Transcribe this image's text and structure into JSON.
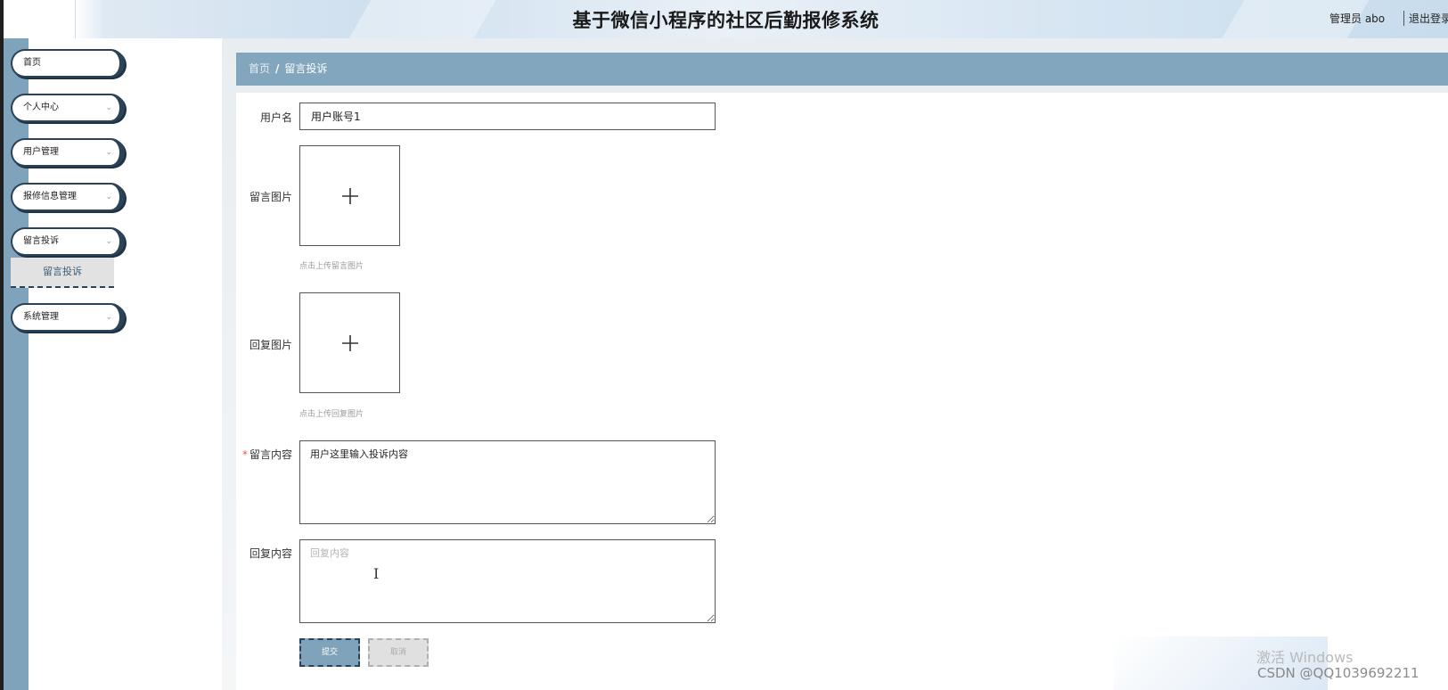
{
  "header": {
    "title": "基于微信小程序的社区后勤报修系统",
    "user_label": "管理员 abo",
    "logout_label": "退出登录"
  },
  "sidebar": {
    "items": [
      {
        "label": "首页",
        "has_chevron": false
      },
      {
        "label": "个人中心",
        "has_chevron": true
      },
      {
        "label": "用户管理",
        "has_chevron": true
      },
      {
        "label": "报修信息管理",
        "has_chevron": true
      },
      {
        "label": "留言投诉",
        "has_chevron": true,
        "expanded": true
      },
      {
        "label": "系统管理",
        "has_chevron": true
      }
    ],
    "sub_items": [
      {
        "label": "留言投诉",
        "parent": "留言投诉",
        "active": true
      }
    ]
  },
  "breadcrumb": {
    "home": "首页",
    "separator": "/",
    "current": "留言投诉"
  },
  "form": {
    "username": {
      "label": "用户名",
      "value": "用户账号1"
    },
    "message_image": {
      "label": "留言图片",
      "hint": "点击上传留言图片"
    },
    "reply_image": {
      "label": "回复图片",
      "hint": "点击上传回复图片"
    },
    "message_content": {
      "label": "留言内容",
      "required_mark": "*",
      "value": "用户这里输入投诉内容"
    },
    "reply_content": {
      "label": "回复内容",
      "placeholder": "回复内容"
    },
    "submit_label": "提交",
    "cancel_label": "取消"
  },
  "overlay": {
    "watermark": "激活 Windows",
    "csdn": "CSDN @QQ1039692211"
  },
  "colors": {
    "accent": "#7fa3ba",
    "sidebar_border": "#2b4257",
    "required": "#e05a5a"
  }
}
